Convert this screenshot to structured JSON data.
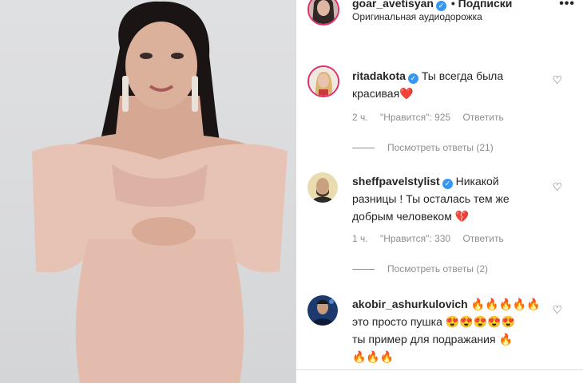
{
  "post": {
    "username": "goar_avetisyan",
    "follow_label": "• Подписки",
    "audio_label": "Оригинальная аудиодорожка",
    "more_icon": "more-horizontal-icon"
  },
  "comments": [
    {
      "username": "ritadakota",
      "text": "Ты всегда была красивая",
      "emoji": "❤️",
      "time": "2 ч.",
      "likes": "\"Нравится\": 925",
      "reply_label": "Ответить",
      "view_replies": "Посмотреть ответы (21)"
    },
    {
      "username": "sheffpavelstylist",
      "text_line1": "Никакой",
      "text_line2": "разницы ! Ты осталась тем же",
      "text_line3": "добрым человеком",
      "emoji": "💔",
      "time": "1 ч.",
      "likes": "\"Нравится\": 330",
      "reply_label": "Ответить",
      "view_replies": "Посмотреть ответы (2)"
    },
    {
      "username": "akobir_ashurkulovich",
      "emoji1": "🔥🔥🔥🔥🔥",
      "text_line2": "это просто пушка",
      "emoji2": "😍😍😍😍😍",
      "text_line3": "ты пример для подражания",
      "emoji3": "🔥",
      "emoji4": "🔥🔥🔥"
    }
  ],
  "colors": {
    "verified": "#3897f0",
    "muted": "#8e8e8e",
    "text": "#262626"
  }
}
